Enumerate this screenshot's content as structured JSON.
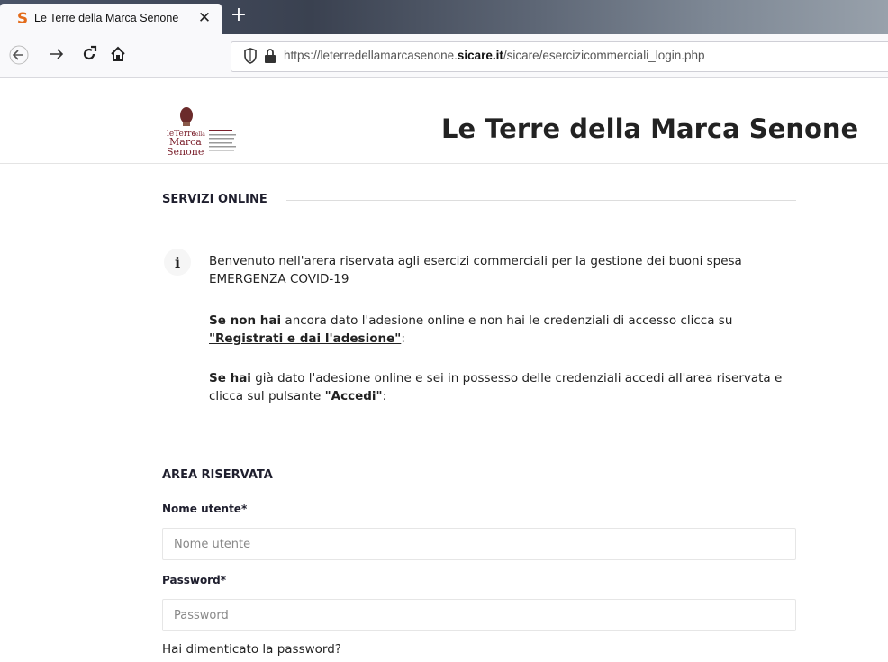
{
  "browser": {
    "tab_title": "Le Terre della Marca Senone",
    "tab_close": "✕",
    "new_tab": "+",
    "url_prefix": "https://leterredellamarcasenone.",
    "url_domain": "sicare.it",
    "url_path": "/sicare/esercizicommerciali_login.php"
  },
  "header": {
    "site_title": "Le Terre della Marca Senone"
  },
  "servizi": {
    "heading": "SERVIZI ONLINE",
    "info_icon_glyph": "i",
    "welcome": "Benvenuto nell'arera riservata agli esercizi commerciali per la gestione dei buoni spesa EMERGENZA COVID-19",
    "p2_bold": "Se non hai",
    "p2_text": " ancora dato l'adesione online e non hai le credenziali di accesso clicca su ",
    "p2_link": "\"Registrati e dai l'adesione\"",
    "p2_end": ":",
    "p3_bold": "Se hai",
    "p3_text": " già dato l'adesione online e sei in possesso delle credenziali accedi all'area riservata e clicca sul pulsante ",
    "p3_bold2": "\"Accedi\"",
    "p3_end": ":"
  },
  "area": {
    "heading": "AREA RISERVATA",
    "username_label": "Nome utente*",
    "username_placeholder": "Nome utente",
    "password_label": "Password*",
    "password_placeholder": "Password",
    "forgot": "Hai dimenticato la password?"
  }
}
